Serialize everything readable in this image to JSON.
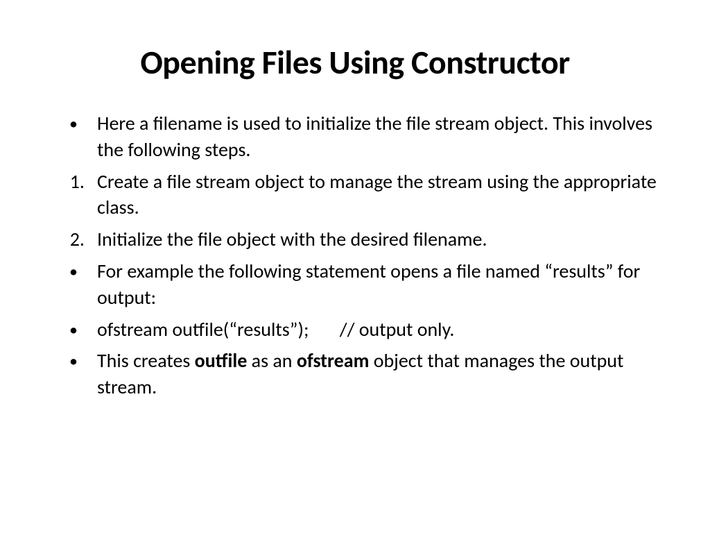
{
  "title": "Opening Files Using Constructor",
  "items": [
    {
      "type": "bullet",
      "text": "Here a filename is used to initialize the file stream object. This involves the following steps."
    },
    {
      "type": "number",
      "num": "1.",
      "text": "Create a file stream object to manage the stream using the appropriate class."
    },
    {
      "type": "number",
      "num": "2.",
      "text": "Initialize the file object with the desired filename."
    },
    {
      "type": "bullet",
      "text": "For example the following statement opens a file named “results” for output:"
    },
    {
      "type": "bullet",
      "text": "ofstream outfile(“results”);       // output only."
    },
    {
      "type": "bullet-rich",
      "parts": [
        {
          "text": "This creates ",
          "bold": false
        },
        {
          "text": "outfile",
          "bold": true
        },
        {
          "text": " as an ",
          "bold": false
        },
        {
          "text": "ofstream",
          "bold": true
        },
        {
          "text": " object that manages the output stream.",
          "bold": false
        }
      ]
    }
  ]
}
